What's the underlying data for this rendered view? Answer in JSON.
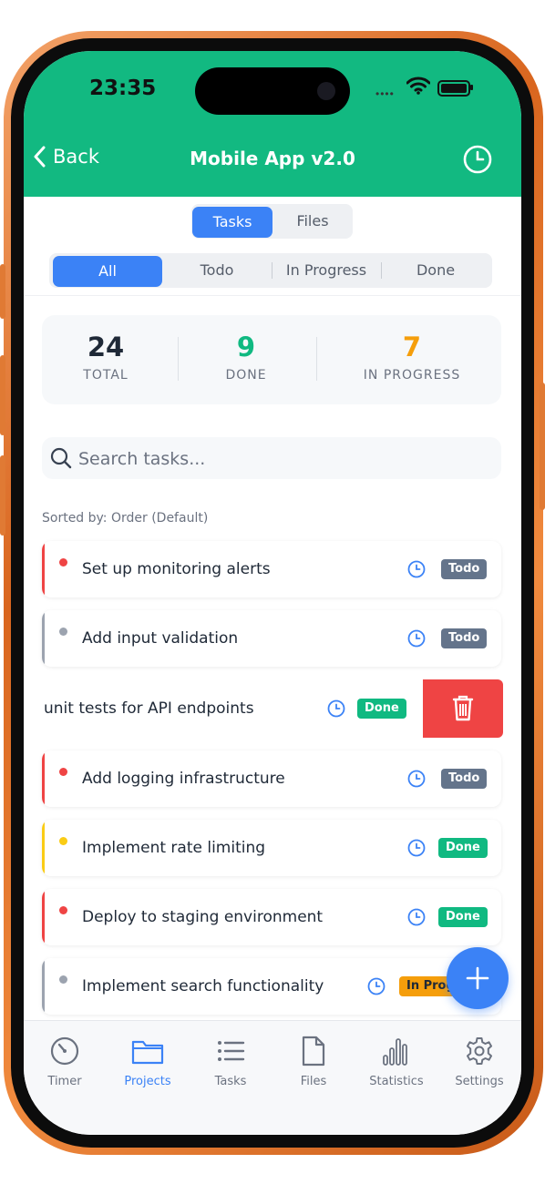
{
  "status_bar": {
    "time": "23:35",
    "signal_dots": "••••"
  },
  "header": {
    "back_label": "Back",
    "title": "Mobile App v2.0",
    "clock_icon": "clock-icon"
  },
  "view_tabs": [
    {
      "label": "Tasks",
      "active": true
    },
    {
      "label": "Files",
      "active": false
    }
  ],
  "filters": [
    {
      "label": "All",
      "active": true
    },
    {
      "label": "Todo"
    },
    {
      "label": "In Progress"
    },
    {
      "label": "Done"
    }
  ],
  "stats": [
    {
      "value": "24",
      "label": "TOTAL",
      "color": "#1f2937"
    },
    {
      "value": "9",
      "label": "DONE",
      "color": "#10b981"
    },
    {
      "value": "7",
      "label": "IN PROGRESS",
      "color": "#f59e0b"
    }
  ],
  "search": {
    "placeholder": "Search tasks..."
  },
  "sorted_label": "Sorted by: Order (Default)",
  "tasks": [
    {
      "name": "Set up monitoring alerts",
      "status": "Todo",
      "priority_color": "#ef4444"
    },
    {
      "name": "Add input validation",
      "status": "Todo",
      "priority_color": "#9ca3af"
    },
    {
      "name": "unit tests for API endpoints",
      "status": "Done",
      "priority_color": "#ef4444",
      "swiped": true
    },
    {
      "name": "Add logging infrastructure",
      "status": "Todo",
      "priority_color": "#ef4444"
    },
    {
      "name": "Implement rate limiting",
      "status": "Done",
      "priority_color": "#facc15"
    },
    {
      "name": "Deploy to staging environment",
      "status": "Done",
      "priority_color": "#ef4444"
    },
    {
      "name": "Implement search functionality",
      "status": "In Prog",
      "priority_color": "#9ca3af"
    }
  ],
  "tab_bar": [
    {
      "label": "Timer",
      "icon": "timer-icon"
    },
    {
      "label": "Projects",
      "icon": "folder-icon",
      "active": true
    },
    {
      "label": "Tasks",
      "icon": "list-icon"
    },
    {
      "label": "Files",
      "icon": "file-icon"
    },
    {
      "label": "Statistics",
      "icon": "bar-chart-icon"
    },
    {
      "label": "Settings",
      "icon": "gear-icon"
    }
  ],
  "colors": {
    "header": "#12b981",
    "accent": "#3b82f6",
    "delete": "#ef4444",
    "phone_frame": "#e07a34"
  }
}
